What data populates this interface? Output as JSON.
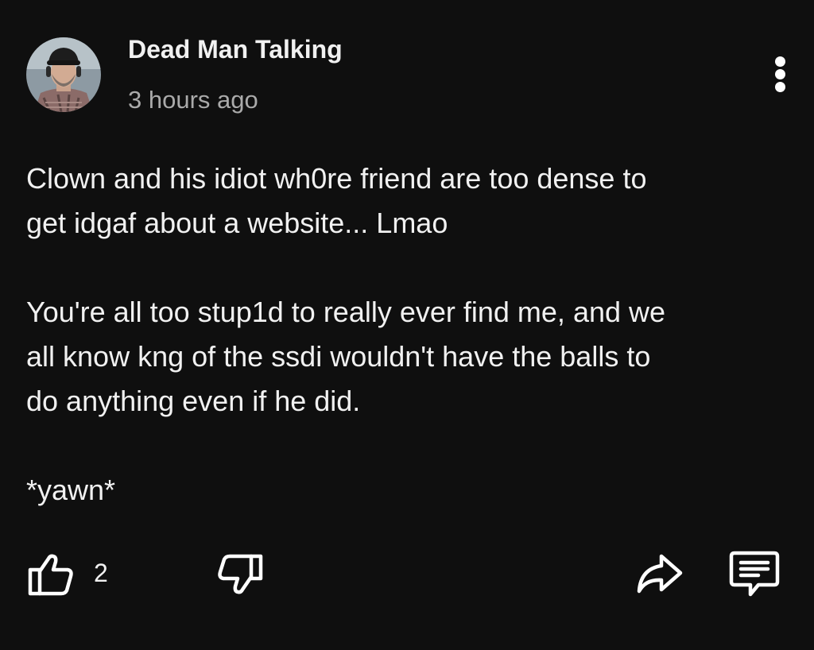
{
  "comment": {
    "author": "Dead Man Talking",
    "timestamp": "3 hours ago",
    "paragraphs": [
      "Clown and his idiot wh0re friend are too dense to\nget idgaf about a website... Lmao",
      "You're all too stup1d to really ever find me, and we\nall know kng of the ssdi wouldn't have the balls to\ndo anything even if he did.",
      "*yawn*"
    ]
  },
  "actions": {
    "like_count": "2",
    "icons": [
      "thumbs-up-icon",
      "thumbs-down-icon",
      "share-icon",
      "reply-icon"
    ]
  },
  "colors": {
    "background": "#0f0f0f",
    "text_primary": "#f1f1f1",
    "text_secondary": "#aaaaaa"
  }
}
